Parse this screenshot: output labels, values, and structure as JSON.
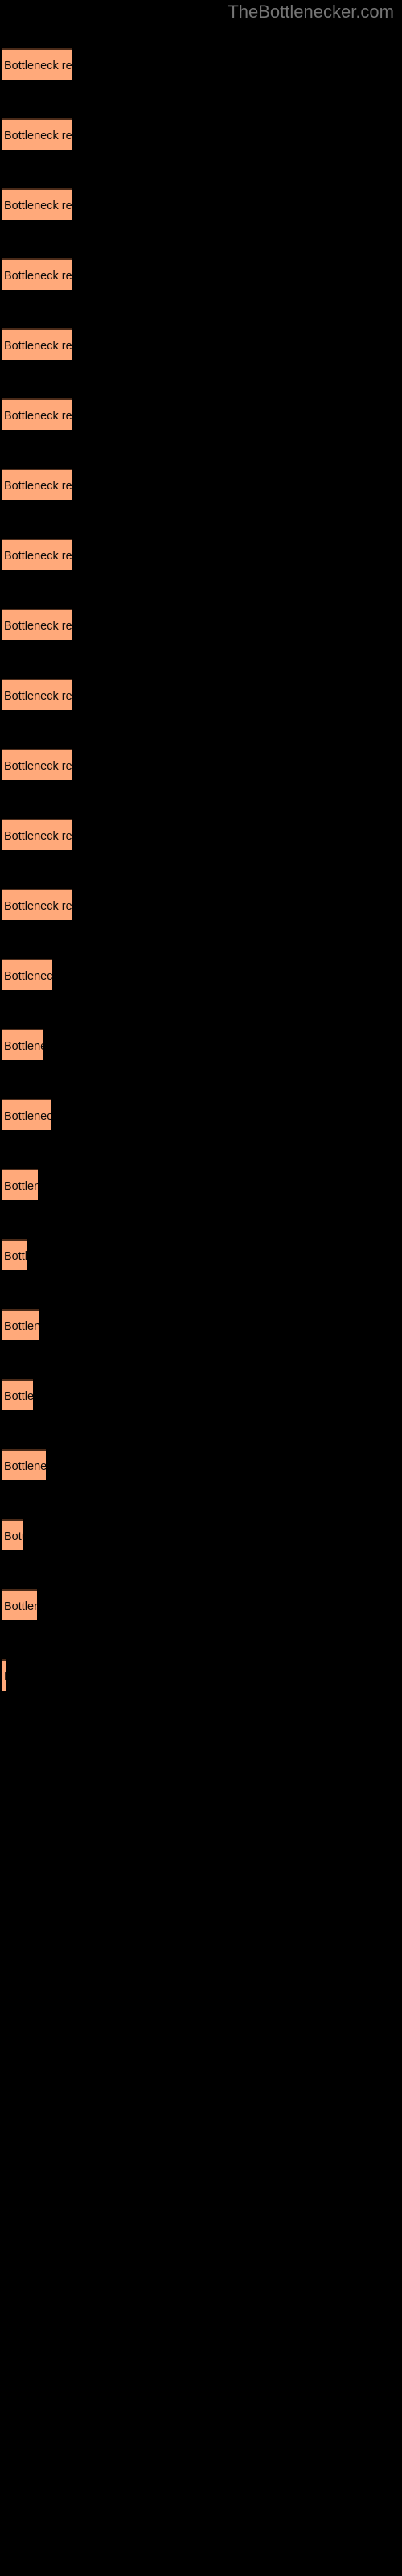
{
  "watermark": {
    "text": "TheBottlenecker.com",
    "color": "#757575"
  },
  "colors": {
    "background": "#000000",
    "bar_fill": "#FFA97A",
    "bar_border_top": "#4a2a18",
    "bar_label": "#0a0a0a",
    "watermark": "#757575"
  },
  "chart_data": {
    "type": "bar",
    "orientation": "horizontal",
    "title": "",
    "subtitle": "",
    "xlabel": "",
    "ylabel": "",
    "grid": false,
    "legend": null,
    "axis_visible": false,
    "tick_labels": [],
    "xlim": [
      0,
      100
    ],
    "bar_label_text": "Bottleneck result",
    "categories": [
      "Bottleneck result",
      "Bottleneck result",
      "Bottleneck result",
      "Bottleneck result",
      "Bottleneck result",
      "Bottleneck result",
      "Bottleneck result",
      "Bottleneck result",
      "Bottleneck result",
      "Bottleneck result",
      "Bottleneck result",
      "Bottleneck result",
      "Bottleneck result",
      "Bottleneck result",
      "Bottleneck result",
      "Bottleneck result",
      "Bottleneck result",
      "Bottleneck result",
      "Bottleneck result",
      "Bottleneck result",
      "Bottleneck result",
      "Bottleneck result",
      "Bottleneck result",
      "Bottleneck result"
    ],
    "values": [
      88,
      88,
      88,
      88,
      88,
      88,
      88,
      88,
      88,
      88,
      88,
      88,
      88,
      63,
      52,
      61,
      45,
      32,
      47,
      39,
      55,
      27,
      44,
      5
    ],
    "bar_top_positions": [
      60,
      103,
      147,
      190,
      234,
      277,
      320,
      364,
      407,
      450,
      494,
      537,
      580,
      624,
      667,
      711,
      754,
      798,
      841,
      884,
      928,
      971,
      1014,
      1058
    ]
  }
}
